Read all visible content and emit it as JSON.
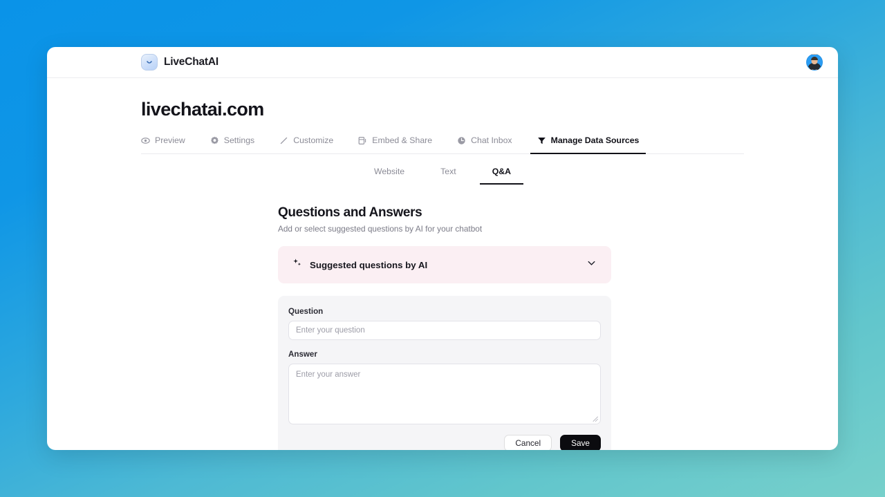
{
  "theme": {
    "gradient_start": "#0a93e8",
    "gradient_end": "#77d0cb",
    "card_bg": "#ffffff",
    "accent_banner": "#fbeff3",
    "form_bg": "#f5f5f7",
    "text_primary": "#13131a",
    "text_muted": "#8b8b96",
    "save_bg": "#0b0b0f"
  },
  "topbar": {
    "brand_name": "LiveChatAI",
    "logo_icon": "smile-logo-icon",
    "avatar_icon": "user-avatar"
  },
  "page": {
    "title": "livechatai.com"
  },
  "nav": {
    "items": [
      {
        "label": "Preview",
        "icon": "eye-icon",
        "active": false
      },
      {
        "label": "Settings",
        "icon": "gear-icon",
        "active": false
      },
      {
        "label": "Customize",
        "icon": "pencil-icon",
        "active": false
      },
      {
        "label": "Embed & Share",
        "icon": "embed-icon",
        "active": false
      },
      {
        "label": "Chat Inbox",
        "icon": "clock-icon",
        "active": false
      },
      {
        "label": "Manage Data Sources",
        "icon": "funnel-icon",
        "active": true
      }
    ]
  },
  "subtabs": {
    "items": [
      {
        "label": "Website",
        "active": false
      },
      {
        "label": "Text",
        "active": false
      },
      {
        "label": "Q&A",
        "active": true
      }
    ]
  },
  "content": {
    "heading": "Questions and Answers",
    "subheading": "Add or select suggested questions by AI for your chatbot",
    "suggested_banner": {
      "label": "Suggested questions by AI",
      "sparkle_icon": "sparkles-icon",
      "chevron_icon": "chevron-down-icon",
      "expanded": false
    },
    "form": {
      "question_label": "Question",
      "question_value": "",
      "question_placeholder": "Enter your question",
      "answer_label": "Answer",
      "answer_value": "",
      "answer_placeholder": "Enter your answer",
      "cancel_label": "Cancel",
      "save_label": "Save"
    }
  }
}
